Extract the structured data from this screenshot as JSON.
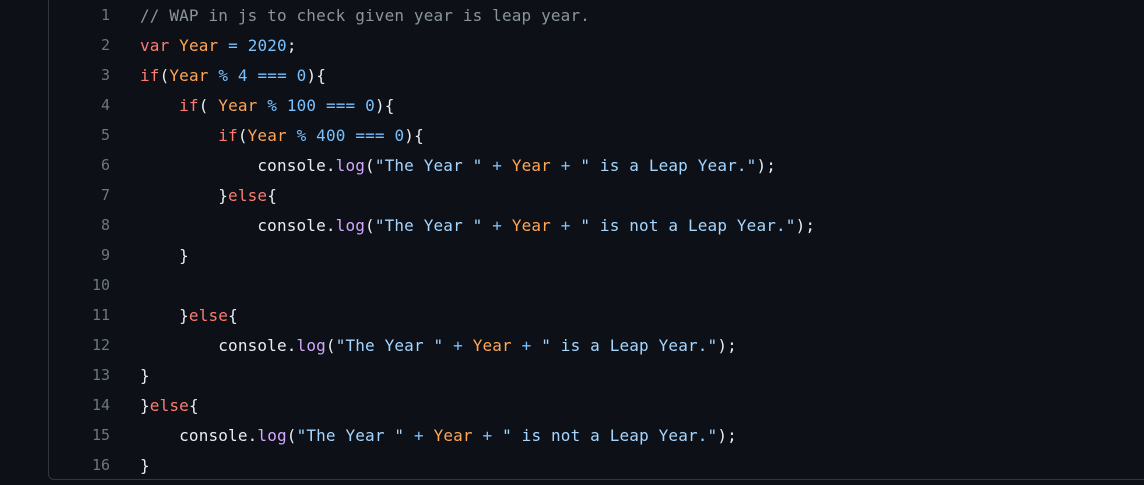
{
  "colors": {
    "background": "#0d1117",
    "comment": "#8b949e",
    "keyword": "#ff7b72",
    "variable": "#ffa657",
    "number": "#79c0ff",
    "function": "#d2a8ff",
    "string": "#a5d6ff",
    "line_number": "#6e7681"
  },
  "lines": [
    {
      "n": "1",
      "tokens": [
        [
          "comment",
          "// WAP in js to check given year is leap year."
        ]
      ]
    },
    {
      "n": "2",
      "tokens": [
        [
          "kw",
          "var"
        ],
        [
          "plain",
          " "
        ],
        [
          "var",
          "Year"
        ],
        [
          "plain",
          " "
        ],
        [
          "op",
          "="
        ],
        [
          "plain",
          " "
        ],
        [
          "num",
          "2020"
        ],
        [
          "plain",
          ";"
        ]
      ]
    },
    {
      "n": "3",
      "tokens": [
        [
          "kw",
          "if"
        ],
        [
          "plain",
          "("
        ],
        [
          "var",
          "Year"
        ],
        [
          "plain",
          " "
        ],
        [
          "op",
          "%"
        ],
        [
          "plain",
          " "
        ],
        [
          "num",
          "4"
        ],
        [
          "plain",
          " "
        ],
        [
          "op",
          "==="
        ],
        [
          "plain",
          " "
        ],
        [
          "num",
          "0"
        ],
        [
          "plain",
          "){"
        ]
      ]
    },
    {
      "n": "4",
      "tokens": [
        [
          "plain",
          "    "
        ],
        [
          "kw",
          "if"
        ],
        [
          "plain",
          "( "
        ],
        [
          "var",
          "Year"
        ],
        [
          "plain",
          " "
        ],
        [
          "op",
          "%"
        ],
        [
          "plain",
          " "
        ],
        [
          "num",
          "100"
        ],
        [
          "plain",
          " "
        ],
        [
          "op",
          "==="
        ],
        [
          "plain",
          " "
        ],
        [
          "num",
          "0"
        ],
        [
          "plain",
          "){"
        ]
      ]
    },
    {
      "n": "5",
      "tokens": [
        [
          "plain",
          "        "
        ],
        [
          "kw",
          "if"
        ],
        [
          "plain",
          "("
        ],
        [
          "var",
          "Year"
        ],
        [
          "plain",
          " "
        ],
        [
          "op",
          "%"
        ],
        [
          "plain",
          " "
        ],
        [
          "num",
          "400"
        ],
        [
          "plain",
          " "
        ],
        [
          "op",
          "==="
        ],
        [
          "plain",
          " "
        ],
        [
          "num",
          "0"
        ],
        [
          "plain",
          "){"
        ]
      ]
    },
    {
      "n": "6",
      "tokens": [
        [
          "plain",
          "            console."
        ],
        [
          "fn",
          "log"
        ],
        [
          "plain",
          "("
        ],
        [
          "str",
          "\"The Year \""
        ],
        [
          "plain",
          " "
        ],
        [
          "op",
          "+"
        ],
        [
          "plain",
          " "
        ],
        [
          "var",
          "Year"
        ],
        [
          "plain",
          " "
        ],
        [
          "op",
          "+"
        ],
        [
          "plain",
          " "
        ],
        [
          "str",
          "\" is a Leap Year.\""
        ],
        [
          "plain",
          ");"
        ]
      ]
    },
    {
      "n": "7",
      "tokens": [
        [
          "plain",
          "        }"
        ],
        [
          "kw",
          "else"
        ],
        [
          "plain",
          "{"
        ]
      ]
    },
    {
      "n": "8",
      "tokens": [
        [
          "plain",
          "            console."
        ],
        [
          "fn",
          "log"
        ],
        [
          "plain",
          "("
        ],
        [
          "str",
          "\"The Year \""
        ],
        [
          "plain",
          " "
        ],
        [
          "op",
          "+"
        ],
        [
          "plain",
          " "
        ],
        [
          "var",
          "Year"
        ],
        [
          "plain",
          " "
        ],
        [
          "op",
          "+"
        ],
        [
          "plain",
          " "
        ],
        [
          "str",
          "\" is not a Leap Year.\""
        ],
        [
          "plain",
          ");"
        ]
      ]
    },
    {
      "n": "9",
      "tokens": [
        [
          "plain",
          "    }"
        ]
      ]
    },
    {
      "n": "10",
      "tokens": []
    },
    {
      "n": "11",
      "tokens": [
        [
          "plain",
          "    }"
        ],
        [
          "kw",
          "else"
        ],
        [
          "plain",
          "{"
        ]
      ]
    },
    {
      "n": "12",
      "tokens": [
        [
          "plain",
          "        console."
        ],
        [
          "fn",
          "log"
        ],
        [
          "plain",
          "("
        ],
        [
          "str",
          "\"The Year \""
        ],
        [
          "plain",
          " "
        ],
        [
          "op",
          "+"
        ],
        [
          "plain",
          " "
        ],
        [
          "var",
          "Year"
        ],
        [
          "plain",
          " "
        ],
        [
          "op",
          "+"
        ],
        [
          "plain",
          " "
        ],
        [
          "str",
          "\" is a Leap Year.\""
        ],
        [
          "plain",
          ");"
        ]
      ]
    },
    {
      "n": "13",
      "tokens": [
        [
          "plain",
          "}"
        ]
      ]
    },
    {
      "n": "14",
      "tokens": [
        [
          "plain",
          "}"
        ],
        [
          "kw",
          "else"
        ],
        [
          "plain",
          "{"
        ]
      ]
    },
    {
      "n": "15",
      "tokens": [
        [
          "plain",
          "    console."
        ],
        [
          "fn",
          "log"
        ],
        [
          "plain",
          "("
        ],
        [
          "str",
          "\"The Year \""
        ],
        [
          "plain",
          " "
        ],
        [
          "op",
          "+"
        ],
        [
          "plain",
          " "
        ],
        [
          "var",
          "Year"
        ],
        [
          "plain",
          " "
        ],
        [
          "op",
          "+"
        ],
        [
          "plain",
          " "
        ],
        [
          "str",
          "\" is not a Leap Year.\""
        ],
        [
          "plain",
          ");"
        ]
      ]
    },
    {
      "n": "16",
      "tokens": [
        [
          "plain",
          "}"
        ]
      ]
    }
  ]
}
